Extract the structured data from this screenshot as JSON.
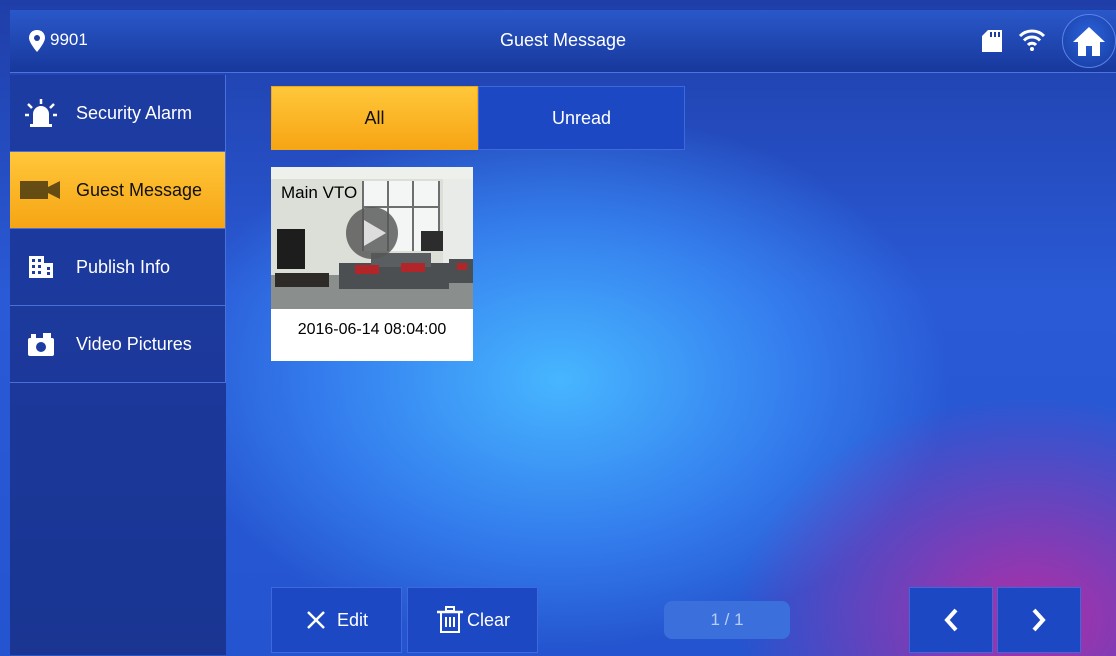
{
  "header": {
    "location_icon": "location-pin-icon",
    "location_text": "9901",
    "title": "Guest Message",
    "status_icons": [
      "sd-card-icon",
      "wifi-icon"
    ],
    "home_icon": "home-icon"
  },
  "sidebar": {
    "items": [
      {
        "icon": "alarm-light-icon",
        "label": "Security Alarm",
        "active": false
      },
      {
        "icon": "video-camera-icon",
        "label": "Guest Message",
        "active": true
      },
      {
        "icon": "building-icon",
        "label": "Publish Info",
        "active": false
      },
      {
        "icon": "camera-icon",
        "label": "Video Pictures",
        "active": false
      }
    ]
  },
  "tabs": [
    {
      "label": "All",
      "active": true
    },
    {
      "label": "Unread",
      "active": false
    }
  ],
  "messages": [
    {
      "source": "Main VTO",
      "timestamp": "2016-06-14 08:04:00",
      "icon": "play-icon"
    }
  ],
  "footer": {
    "edit_label": "Edit",
    "clear_label": "Clear",
    "page": "1 / 1",
    "prev_icon": "chevron-left-icon",
    "next_icon": "chevron-right-icon"
  },
  "colors": {
    "accent": "#f6a514",
    "bar": "#17389c",
    "button": "#1d48c4"
  }
}
